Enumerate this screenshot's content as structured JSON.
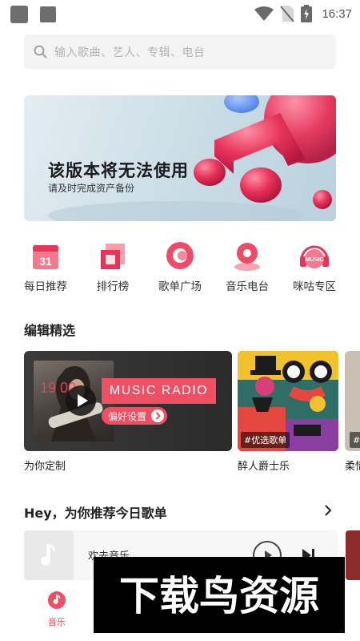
{
  "status_bar": {
    "time": "16:37",
    "icons": [
      "notification-square-icon",
      "notification-square-icon",
      "wifi-icon",
      "no-sim-icon",
      "battery-charging-icon"
    ]
  },
  "search": {
    "placeholder": "输入歌曲、艺人、专辑、电台"
  },
  "banner": {
    "title": "该版本将无法使用",
    "subtitle": "请及时完成资产备份"
  },
  "quick_nav": [
    {
      "label": "每日推荐",
      "icon": "calendar-icon",
      "icon_text": "31"
    },
    {
      "label": "排行榜",
      "icon": "chart-icon"
    },
    {
      "label": "歌单广场",
      "icon": "playlist-icon"
    },
    {
      "label": "音乐电台",
      "icon": "radio-icon"
    },
    {
      "label": "咪咕专区",
      "icon": "migu-headphones-icon",
      "icon_text": "MUSIC"
    }
  ],
  "editor_picks": {
    "title": "编辑精选",
    "main": {
      "radio_text": "MUSIC RADIO",
      "preference_button": "偏好设置",
      "label": "为你定制",
      "photo_text": "19 00"
    },
    "cards": [
      {
        "tag": "#优选歌单",
        "label": "醉人爵士乐"
      },
      {
        "tag": "#经",
        "label": "柔情"
      }
    ]
  },
  "recommend": {
    "title": "Hey，为你推荐今日歌单",
    "first_item_name": "欢去音乐"
  },
  "bottom_nav": {
    "active_label": "音乐"
  },
  "watermark": {
    "text": "下载鸟资源"
  },
  "colors": {
    "accent": "#ef4f63",
    "search_bg": "#f3f3f3",
    "text_primary": "#222222",
    "text_placeholder": "#b3b3b3"
  }
}
